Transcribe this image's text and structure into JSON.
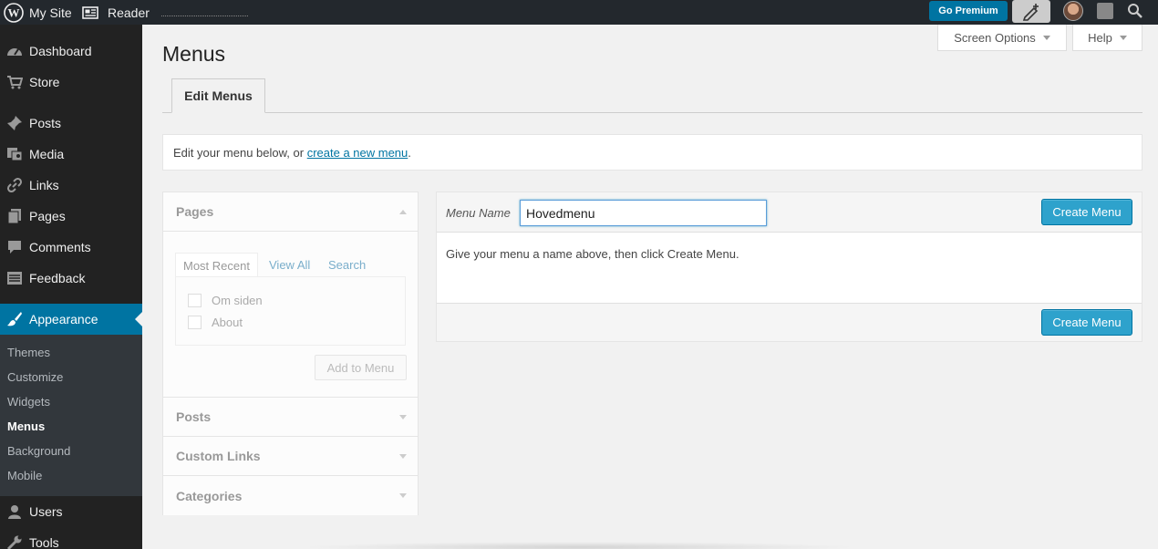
{
  "adminbar": {
    "my_site": "My Site",
    "reader": "Reader",
    "go_premium": "Go Premium"
  },
  "sidebar": {
    "items": [
      {
        "label": "Dashboard",
        "icon": "dashboard-icon"
      },
      {
        "label": "Store",
        "icon": "cart-icon"
      },
      {
        "label": "Posts",
        "icon": "pin-icon"
      },
      {
        "label": "Media",
        "icon": "media-icon"
      },
      {
        "label": "Links",
        "icon": "link-icon"
      },
      {
        "label": "Pages",
        "icon": "pages-icon"
      },
      {
        "label": "Comments",
        "icon": "comment-icon"
      },
      {
        "label": "Feedback",
        "icon": "feedback-icon"
      },
      {
        "label": "Appearance",
        "icon": "brush-icon"
      },
      {
        "label": "Users",
        "icon": "user-icon"
      },
      {
        "label": "Tools",
        "icon": "wrench-icon"
      }
    ],
    "submenu": [
      "Themes",
      "Customize",
      "Widgets",
      "Menus",
      "Background",
      "Mobile"
    ]
  },
  "header": {
    "title": "Menus",
    "screen_options": "Screen Options",
    "help": "Help",
    "tab_edit": "Edit Menus"
  },
  "notice": {
    "prefix": "Edit your menu below, or ",
    "link": "create a new menu",
    "suffix": "."
  },
  "accordion": {
    "pages_title": "Pages",
    "tabs": [
      "Most Recent",
      "View All",
      "Search"
    ],
    "pages": [
      "Om siden",
      "About"
    ],
    "add_button": "Add to Menu",
    "sections": [
      "Posts",
      "Custom Links",
      "Categories"
    ]
  },
  "menu_editor": {
    "name_label": "Menu Name",
    "name_value": "Hovedmenu",
    "create_label": "Create Menu",
    "instruction": "Give your menu a name above, then click Create Menu."
  },
  "colors": {
    "adminbar_bg": "#23282d",
    "sidebar_bg": "#222222",
    "active_blue": "#0074a2",
    "button_blue": "#2ea2cc"
  }
}
